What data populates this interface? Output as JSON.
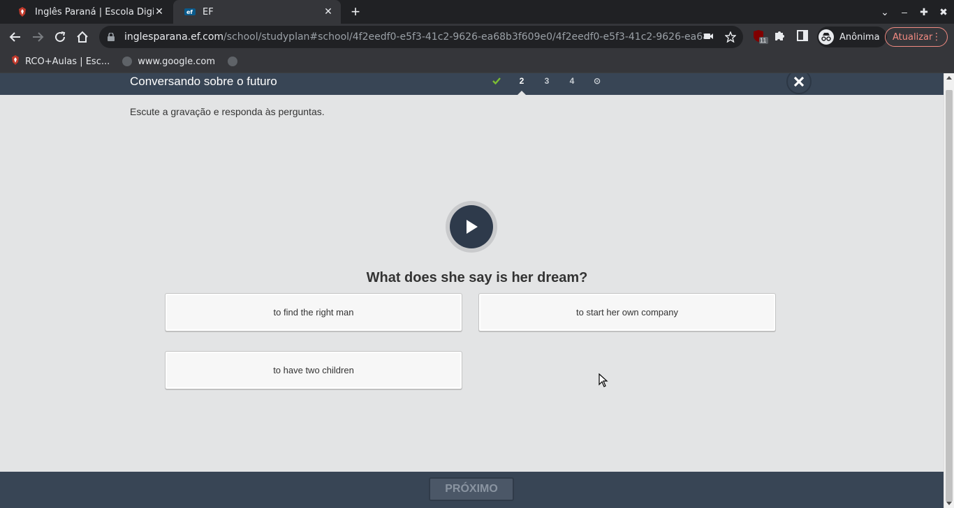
{
  "browser": {
    "tabs": [
      {
        "title": "Inglês Paraná | Escola Digital",
        "active": false
      },
      {
        "title": "EF",
        "active": true
      }
    ],
    "address": {
      "host": "inglesparana.ef.com",
      "path": "/school/studyplan#school/4f2eedf0-e5f3-41c2-9626-ea68b3f609e0/4f2eedf0-e5f3-41c2-9626-ea68b3f..."
    },
    "extension_badge": "11",
    "profile_label": "Anônima",
    "update_label": "Atualizar",
    "bookmarks": [
      {
        "label": "RCO+Aulas | Esc..."
      },
      {
        "label": "www.google.com"
      }
    ]
  },
  "activity": {
    "title": "Conversando sobre o futuro",
    "steps": [
      {
        "label": "✔",
        "state": "done"
      },
      {
        "label": "2",
        "state": "current"
      },
      {
        "label": "3",
        "state": "todo"
      },
      {
        "label": "4",
        "state": "todo"
      },
      {
        "label": "⊙",
        "state": "summary"
      }
    ],
    "instruction": "Escute a gravação e responda às perguntas.",
    "question": "What does she say is her dream?",
    "answers": [
      {
        "label": "to find the right man"
      },
      {
        "label": "to start her own company"
      },
      {
        "label": "to have two children"
      }
    ],
    "next_label": "PRÓXIMO"
  },
  "colors": {
    "header_bg": "#384555",
    "page_bg": "#e3e4e5",
    "check_green": "#7cbd33",
    "update_accent": "#f28b82"
  }
}
